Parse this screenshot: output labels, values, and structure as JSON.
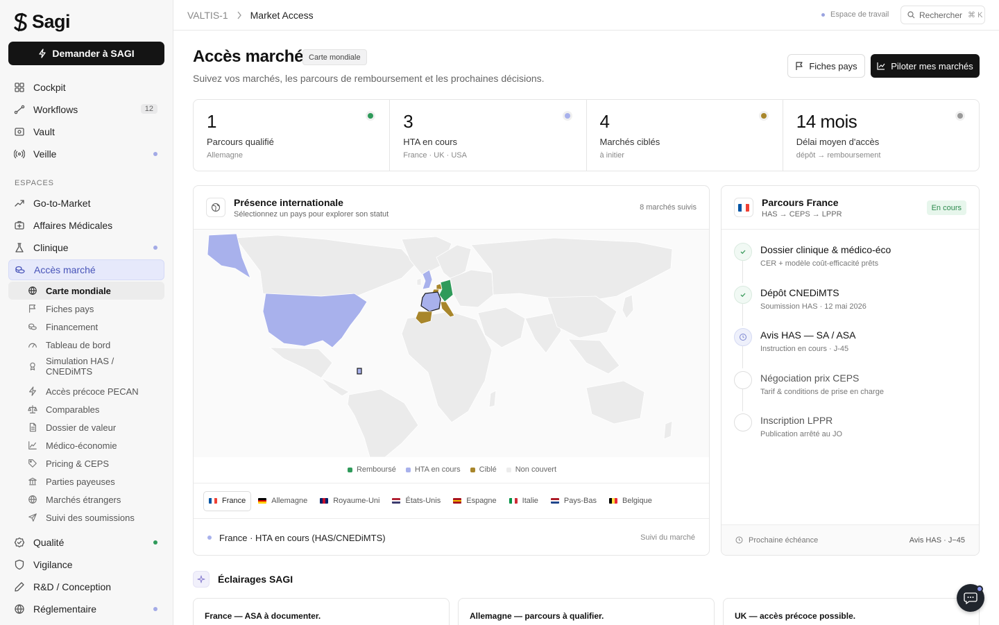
{
  "app": {
    "name": "Sagi",
    "ask_button": "Demander à SAGI"
  },
  "sidebar": {
    "main": [
      {
        "label": "Cockpit",
        "icon": "grid-icon"
      },
      {
        "label": "Workflows",
        "icon": "workflow-icon",
        "badge": "12"
      },
      {
        "label": "Vault",
        "icon": "vault-icon"
      },
      {
        "label": "Veille",
        "icon": "radar-icon",
        "dot": "#a3aae6"
      }
    ],
    "section_label": "ESPACES",
    "spaces": [
      {
        "label": "Go-to-Market",
        "icon": "trend-icon"
      },
      {
        "label": "Affaires Médicales",
        "icon": "medical-case-icon"
      },
      {
        "label": "Clinique",
        "icon": "flask-icon",
        "dot": "#a3aae6"
      },
      {
        "label": "Accès marché",
        "icon": "coins-icon",
        "active": true
      }
    ],
    "submenu": [
      {
        "label": "Carte mondiale",
        "icon": "globe-icon",
        "active": true
      },
      {
        "label": "Fiches pays",
        "icon": "flag-icon"
      },
      {
        "label": "Financement",
        "icon": "coins-icon"
      },
      {
        "label": "Tableau de bord",
        "icon": "gauge-icon"
      },
      {
        "label": "Simulation HAS /",
        "label2": "CNEDiMTS",
        "icon": "medal-icon"
      },
      {
        "label": "Accès précoce PECAN",
        "icon": "bolt-icon"
      },
      {
        "label": "Comparables",
        "icon": "scale-icon"
      },
      {
        "label": "Dossier de valeur",
        "icon": "doc-icon"
      },
      {
        "label": "Médico-économie",
        "icon": "chart-line-icon"
      },
      {
        "label": "Pricing & CEPS",
        "icon": "tag-icon"
      },
      {
        "label": "Parties payeuses",
        "icon": "bank-icon"
      },
      {
        "label": "Marchés étrangers",
        "icon": "globe-icon"
      },
      {
        "label": "Suivi des soumissions",
        "icon": "send-icon"
      }
    ],
    "bottom": [
      {
        "label": "Qualité",
        "icon": "badge-check-icon",
        "dot": "#2f9a5a"
      },
      {
        "label": "Vigilance",
        "icon": "shield-icon"
      },
      {
        "label": "R&D / Conception",
        "icon": "pencil-icon"
      },
      {
        "label": "Réglementaire",
        "icon": "globe-icon",
        "dot": "#a3aae6"
      }
    ]
  },
  "topbar": {
    "breadcrumb": [
      "VALTIS-1",
      "Market Access"
    ],
    "workspace": "Espace de travail",
    "search_label": "Rechercher",
    "search_shortcut": "⌘ K"
  },
  "header": {
    "title": "Accès marché",
    "tag": "Carte mondiale",
    "subtitle": "Suivez vos marchés, les parcours de remboursement et les prochaines décisions.",
    "btn_secondary": "Fiches pays",
    "btn_primary": "Piloter mes marchés"
  },
  "stats": [
    {
      "value": "1",
      "label": "Parcours qualifié",
      "sub": "Allemagne",
      "color": "#2f9a5a"
    },
    {
      "value": "3",
      "label": "HTA en cours",
      "sub": "France · UK · USA",
      "color": "#a8b1ec"
    },
    {
      "value": "4",
      "label": "Marchés ciblés",
      "sub": "à initier",
      "color": "#a8862b"
    },
    {
      "value": "14 mois",
      "label": "Délai moyen d'accès",
      "sub": "dépôt → remboursement",
      "color": "#999999"
    }
  ],
  "map_card": {
    "title": "Présence internationale",
    "subtitle": "Sélectionnez un pays pour explorer son statut",
    "right": "8 marchés suivis",
    "legend": [
      {
        "label": "Remboursé",
        "color": "#2f9a5a"
      },
      {
        "label": "HTA en cours",
        "color": "#a8b1ec"
      },
      {
        "label": "Ciblé",
        "color": "#a8862b"
      },
      {
        "label": "Non couvert",
        "color": "#ececec"
      }
    ],
    "countries": [
      {
        "label": "France",
        "flag": [
          "#0055a4",
          "#ffffff",
          "#ef4135"
        ],
        "active": true
      },
      {
        "label": "Allemagne",
        "flag": [
          "#000000",
          "#dd0000",
          "#ffce00"
        ],
        "dir": "h"
      },
      {
        "label": "Royaume-Uni",
        "flag": [
          "#012169",
          "#c8102e",
          "#012169"
        ]
      },
      {
        "label": "États-Unis",
        "flag": [
          "#b22234",
          "#ffffff",
          "#3c3b6e"
        ],
        "dir": "h"
      },
      {
        "label": "Espagne",
        "flag": [
          "#aa151b",
          "#f1bf00",
          "#aa151b"
        ],
        "dir": "h"
      },
      {
        "label": "Italie",
        "flag": [
          "#009246",
          "#ffffff",
          "#ce2b37"
        ]
      },
      {
        "label": "Pays-Bas",
        "flag": [
          "#ae1c28",
          "#ffffff",
          "#21468b"
        ],
        "dir": "h"
      },
      {
        "label": "Belgique",
        "flag": [
          "#000000",
          "#fae042",
          "#ed2939"
        ]
      }
    ],
    "status_text": "France · HTA en cours (HAS/CNEDiMTS)",
    "status_right": "Suivi du marché"
  },
  "parcours": {
    "title": "Parcours France",
    "subtitle": "HAS → CEPS → LPPR",
    "tag": "En cours",
    "steps": [
      {
        "title": "Dossier clinique & médico-éco",
        "sub": "CER + modèle coût-efficacité prêts",
        "state": "done"
      },
      {
        "title": "Dépôt CNEDiMTS",
        "sub": "Soumission HAS · 12 mai 2026",
        "state": "done"
      },
      {
        "title": "Avis HAS — SA / ASA",
        "sub": "Instruction en cours · J-45",
        "state": "current"
      },
      {
        "title": "Négociation prix CEPS",
        "sub": "Tarif & conditions de prise en charge",
        "state": "todo"
      },
      {
        "title": "Inscription LPPR",
        "sub": "Publication arrêté au JO",
        "state": "todo"
      }
    ],
    "footer_label": "Prochaine échéance",
    "footer_value": "Avis HAS · J−45"
  },
  "insights": {
    "title": "Éclairages SAGI",
    "cards": [
      "France — ASA à documenter.",
      "Allemagne — parcours à qualifier.",
      "UK — accès précoce possible."
    ]
  }
}
